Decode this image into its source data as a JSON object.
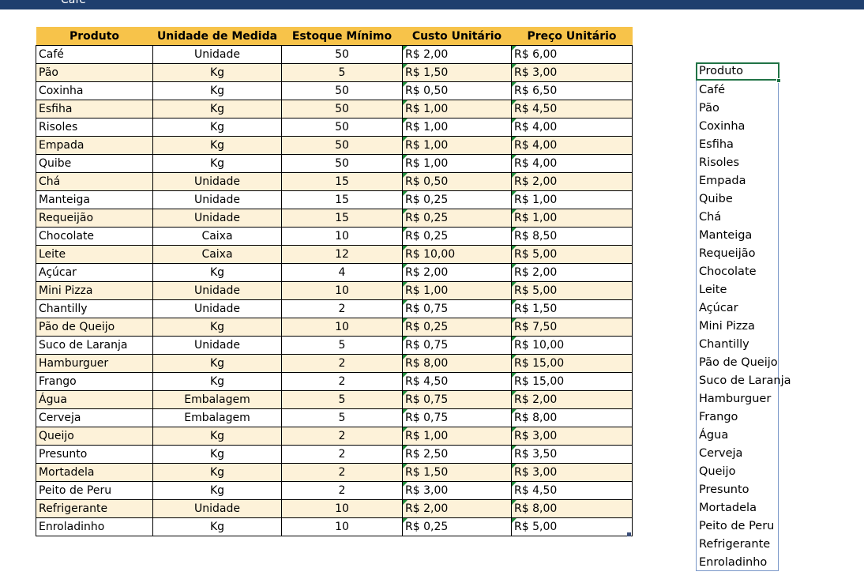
{
  "header": {
    "title_fragment": "Café"
  },
  "table": {
    "columns": [
      "Produto",
      "Unidade de Medida",
      "Estoque Mínimo",
      "Custo Unitário",
      "Preço Unitário"
    ],
    "rows": [
      [
        "Café",
        "Unidade",
        "50",
        "R$ 2,00",
        "R$ 6,00"
      ],
      [
        "Pão",
        "Kg",
        "5",
        "R$ 1,50",
        "R$ 3,00"
      ],
      [
        "Coxinha",
        "Kg",
        "50",
        "R$ 0,50",
        "R$ 6,50"
      ],
      [
        "Esfiha",
        "Kg",
        "50",
        "R$ 1,00",
        "R$ 4,50"
      ],
      [
        "Risoles",
        "Kg",
        "50",
        "R$ 1,00",
        "R$ 4,00"
      ],
      [
        "Empada",
        "Kg",
        "50",
        "R$ 1,00",
        "R$ 4,00"
      ],
      [
        "Quibe",
        "Kg",
        "50",
        "R$ 1,00",
        "R$ 4,00"
      ],
      [
        "Chá",
        "Unidade",
        "15",
        "R$ 0,50",
        "R$ 2,00"
      ],
      [
        "Manteiga",
        "Unidade",
        "15",
        "R$ 0,25",
        "R$ 1,00"
      ],
      [
        "Requeijão",
        "Unidade",
        "15",
        "R$ 0,25",
        "R$ 1,00"
      ],
      [
        "Chocolate",
        "Caixa",
        "10",
        "R$ 0,25",
        "R$ 8,50"
      ],
      [
        "Leite",
        "Caixa",
        "12",
        "R$ 10,00",
        "R$ 5,00"
      ],
      [
        "Açúcar",
        "Kg",
        "4",
        "R$ 2,00",
        "R$ 2,00"
      ],
      [
        "Mini Pizza",
        "Unidade",
        "10",
        "R$ 1,00",
        "R$ 5,00"
      ],
      [
        "Chantilly",
        "Unidade",
        "2",
        "R$ 0,75",
        "R$ 1,50"
      ],
      [
        "Pão de Queijo",
        "Kg",
        "10",
        "R$ 0,25",
        "R$ 7,50"
      ],
      [
        "Suco de Laranja",
        "Unidade",
        "5",
        "R$ 0,75",
        "R$ 10,00"
      ],
      [
        "Hamburguer",
        "Kg",
        "2",
        "R$ 8,00",
        "R$ 15,00"
      ],
      [
        "Frango",
        "Kg",
        "2",
        "R$ 4,50",
        "R$ 15,00"
      ],
      [
        "Água",
        "Embalagem",
        "5",
        "R$ 0,75",
        "R$ 2,00"
      ],
      [
        "Cerveja",
        "Embalagem",
        "5",
        "R$ 0,75",
        "R$ 8,00"
      ],
      [
        "Queijo",
        "Kg",
        "2",
        "R$ 1,00",
        "R$ 3,00"
      ],
      [
        "Presunto",
        "Kg",
        "2",
        "R$ 2,50",
        "R$ 3,50"
      ],
      [
        "Mortadela",
        "Kg",
        "2",
        "R$ 1,50",
        "R$ 3,00"
      ],
      [
        "Peito de Peru",
        "Kg",
        "2",
        "R$ 3,00",
        "R$ 4,50"
      ],
      [
        "Refrigerante",
        "Unidade",
        "10",
        "R$ 2,00",
        "R$ 8,00"
      ],
      [
        "Enroladinho",
        "Kg",
        "10",
        "R$ 0,25",
        "R$ 5,00"
      ]
    ]
  },
  "product_list": {
    "header": "Produto",
    "items": [
      "Café",
      "Pão",
      "Coxinha",
      "Esfiha",
      "Risoles",
      "Empada",
      "Quibe",
      "Chá",
      "Manteiga",
      "Requeijão",
      "Chocolate",
      "Leite",
      "Açúcar",
      "Mini Pizza",
      "Chantilly",
      "Pão de Queijo",
      "Suco de Laranja",
      "Hamburguer",
      "Frango",
      "Água",
      "Cerveja",
      "Queijo",
      "Presunto",
      "Mortadela",
      "Peito de Peru",
      "Refrigerante",
      "Enroladinho"
    ]
  },
  "colors": {
    "header_fill": "#f7c34a",
    "band_fill": "#fdf2d9",
    "top_bar": "#1f3f6e",
    "selection": "#217346",
    "error_indicator": "#1e8a3a"
  }
}
